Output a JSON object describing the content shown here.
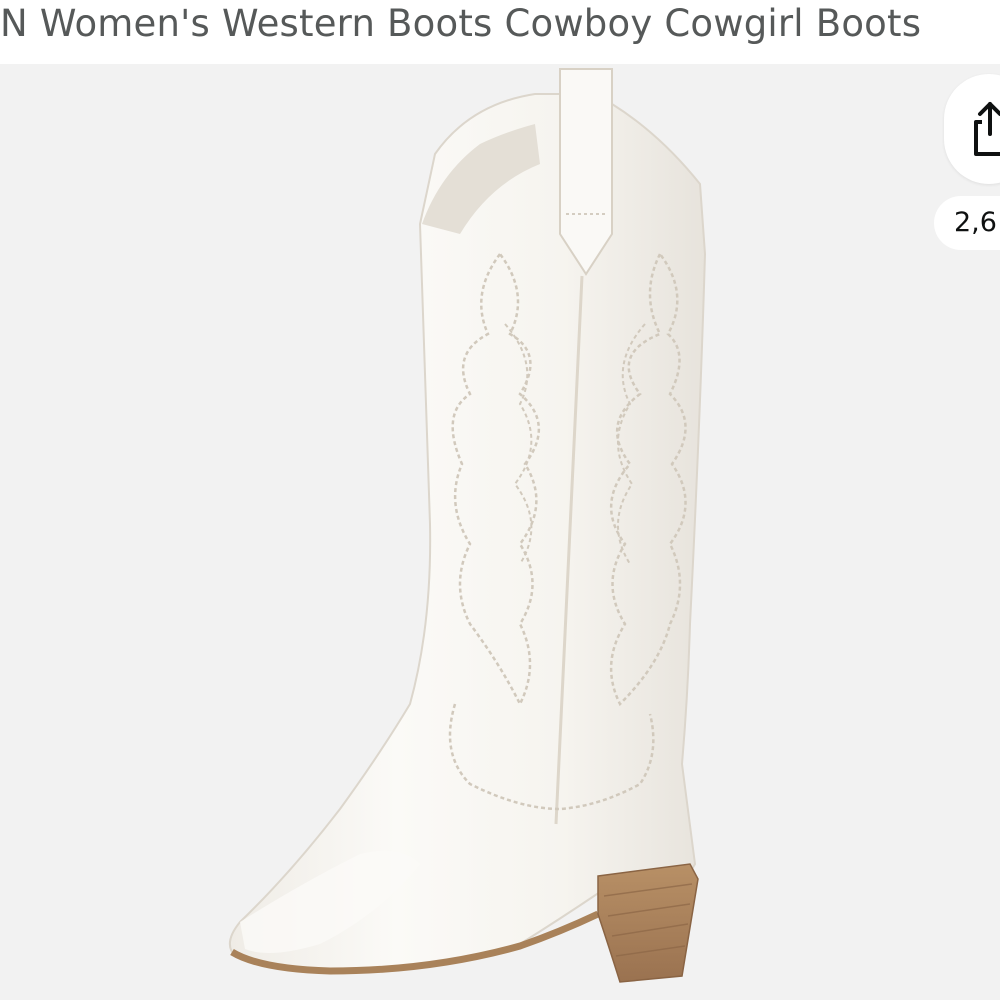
{
  "product": {
    "title": "N Women's Western Boots Cowboy Cowgirl Boots",
    "image_alt": "white-western-cowboy-boot"
  },
  "actions": {
    "share_icon": "share-icon",
    "count_text": "2,6"
  },
  "colors": {
    "title": "#565959",
    "image_background": "#f2f2f2",
    "boot": "#f7f5f1",
    "stitching": "#d4cdc1",
    "heel": "#a9825a"
  }
}
